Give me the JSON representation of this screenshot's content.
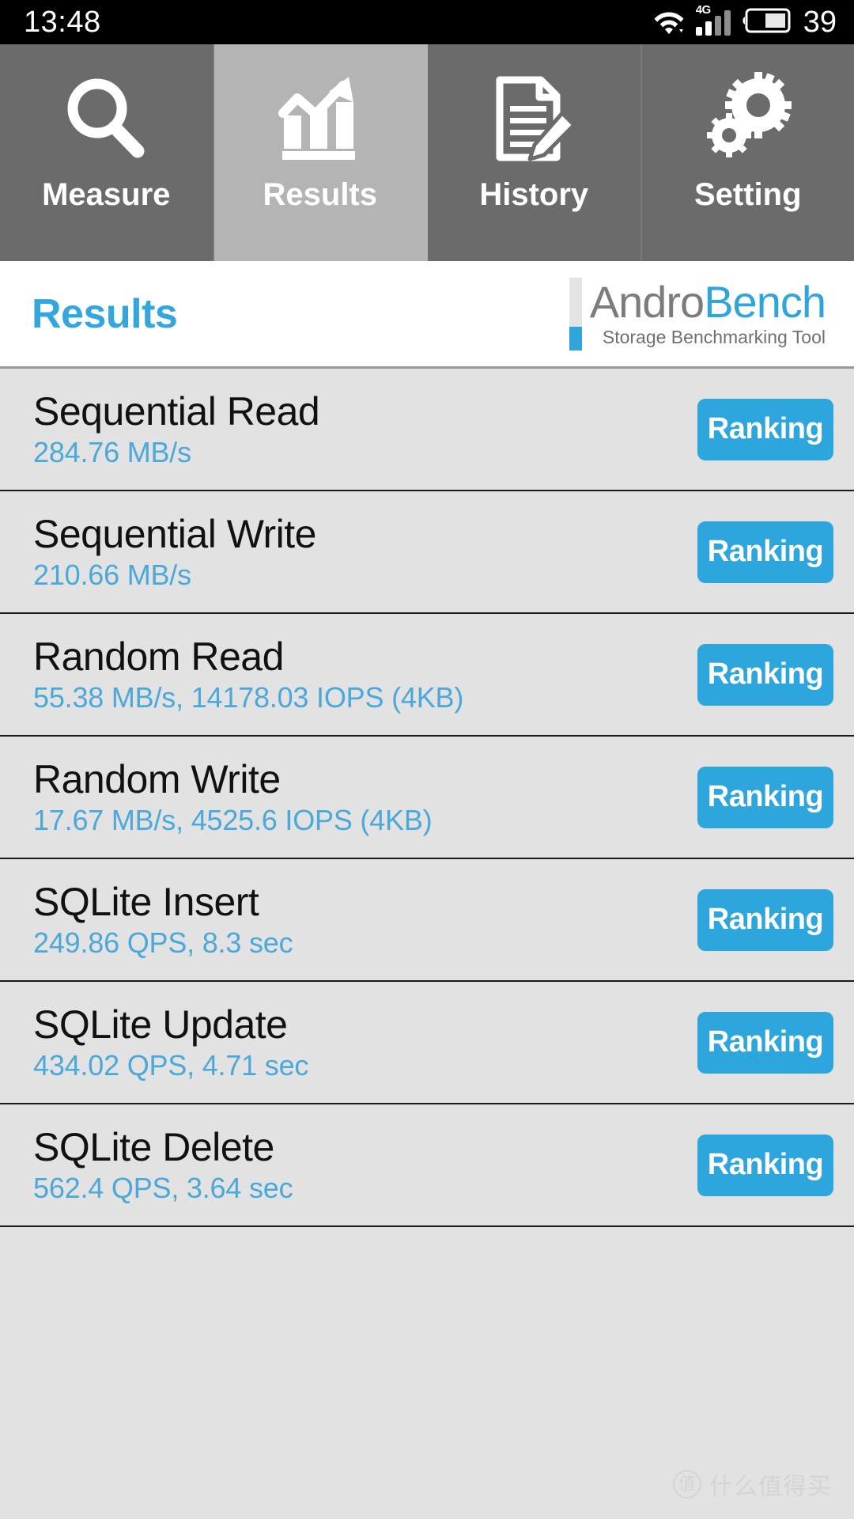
{
  "statusbar": {
    "time": "13:48",
    "wifi_icon": "wifi-icon",
    "network_label": "4G",
    "signal_icon": "signal-bars-icon",
    "battery_icon": "battery-icon",
    "battery_level": "39"
  },
  "tabs": [
    {
      "label": "Measure",
      "icon": "magnifier-icon",
      "active": false
    },
    {
      "label": "Results",
      "icon": "bar-chart-arrow-icon",
      "active": true
    },
    {
      "label": "History",
      "icon": "document-pencil-icon",
      "active": false
    },
    {
      "label": "Setting",
      "icon": "gears-icon",
      "active": false
    }
  ],
  "header": {
    "title": "Results",
    "brand_first": "Andro",
    "brand_second": "Bench",
    "brand_tagline": "Storage Benchmarking Tool"
  },
  "results": {
    "ranking_label": "Ranking",
    "rows": [
      {
        "name": "Sequential Read",
        "value": "284.76 MB/s"
      },
      {
        "name": "Sequential Write",
        "value": "210.66 MB/s"
      },
      {
        "name": "Random Read",
        "value": "55.38 MB/s, 14178.03 IOPS (4KB)"
      },
      {
        "name": "Random Write",
        "value": "17.67 MB/s, 4525.6 IOPS (4KB)"
      },
      {
        "name": "SQLite Insert",
        "value": "249.86 QPS, 8.3 sec"
      },
      {
        "name": "SQLite Update",
        "value": "434.02 QPS, 4.71 sec"
      },
      {
        "name": "SQLite Delete",
        "value": "562.4 QPS, 3.64 sec"
      }
    ]
  },
  "watermark": {
    "mark": "值",
    "text": "什么值得买"
  },
  "colors": {
    "accent_blue": "#2da5dd",
    "value_blue": "#4aa8da",
    "tab_inactive": "#6b6b6b",
    "tab_active": "#b4b4b4",
    "list_bg": "#e2e2e2"
  }
}
